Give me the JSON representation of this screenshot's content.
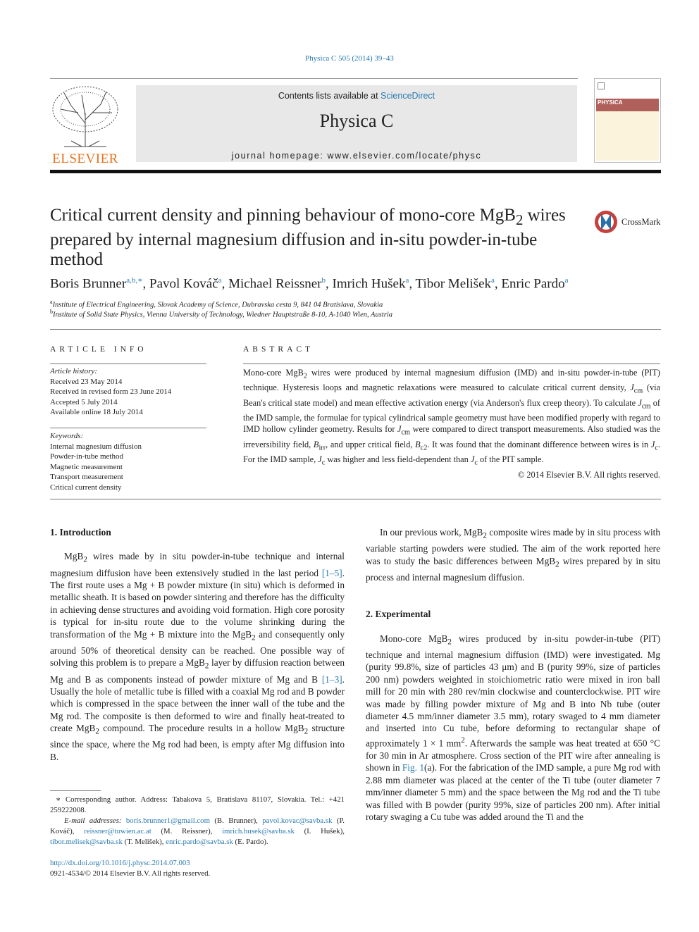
{
  "journal_ref": "Physica C 505 (2014) 39–43",
  "banner": {
    "contents_prefix": "Contents lists available at ",
    "contents_link": "ScienceDirect",
    "journal_title": "Physica C",
    "homepage": "journal homepage: www.elsevier.com/locate/physc"
  },
  "publisher_logo": "ELSEVIER",
  "cover_label": "PHYSICA",
  "crossmark": "CrossMark",
  "title": "Critical current density and pinning behaviour of mono-core MgB<sub>2</sub> wires prepared by internal magnesium diffusion and in-situ powder-in-tube method",
  "authors": "Boris Brunner<sup>a,b,∗</sup>, Pavol Kováč<sup>a</sup>, Michael Reissner<sup>b</sup>, Imrich Hušek<sup>a</sup>, Tibor Melišek<sup>a</sup>, Enric Pardo<sup>a</sup>",
  "affiliations": [
    "<sup>a</sup>Institute of Electrical Engineering, Slovak Academy of Science, Dubravska cesta 9, 841 04 Bratislava, Slovakia",
    "<sup>b</sup>Institute of Solid State Physics, Vienna University of Technology, Wiedner Hauptstraße 8-10, A-1040 Wien, Austria"
  ],
  "article_info": {
    "heading": "ARTICLE INFO",
    "history_label": "Article history:",
    "history": [
      "Received 23 May 2014",
      "Received in revised form 23 June 2014",
      "Accepted 5 July 2014",
      "Available online 18 July 2014"
    ],
    "keywords_label": "Keywords:",
    "keywords": [
      "Internal magnesium diffusion",
      "Powder-in-tube method",
      "Magnetic measurement",
      "Transport measurement",
      "Critical current density"
    ]
  },
  "abstract": {
    "heading": "ABSTRACT",
    "text": "Mono-core MgB<sub>2</sub> wires were produced by internal magnesium diffusion (IMD) and in-situ powder-in-tube (PIT) technique. Hysteresis loops and magnetic relaxations were measured to calculate critical current density, <i>J</i><sub>cm</sub> (via Bean's critical state model) and mean effective activation energy (via Anderson's flux creep theory). To calculate <i>J</i><sub>cm</sub> of the IMD sample, the formulae for typical cylindrical sample geometry must have been modified properly with regard to IMD hollow cylinder geometry. Results for <i>J</i><sub>cm</sub> were compared to direct transport measurements. Also studied was the irreversibility field, <i>B</i><sub>irr</sub>, and upper critical field, <i>B</i><sub>c2</sub>. It was found that the dominant difference between wires is in <i>J</i><sub>c</sub>. For the IMD sample, <i>J</i><sub>c</sub> was higher and less field-dependent than <i>J</i><sub>c</sub> of the PIT sample.",
    "copyright": "© 2014 Elsevier B.V. All rights reserved."
  },
  "intro": {
    "heading": "1. Introduction",
    "paragraphs": [
      "MgB<sub>2</sub> wires made by in situ powder-in-tube technique and internal magnesium diffusion have been extensively studied in the last period <a>[1–5]</a>. The first route uses a Mg + B powder mixture (in situ) which is deformed in metallic sheath. It is based on powder sintering and therefore has the difficulty in achieving dense structures and avoiding void formation. High core porosity is typical for in-situ route due to the volume shrinking during the transformation of the Mg + B mixture into the MgB<sub>2</sub> and consequently only around 50% of theoretical density can be reached. One possible way of solving this problem is to prepare a MgB<sub>2</sub> layer by diffusion reaction between Mg and B as components instead of powder mixture of Mg and B <a>[1–3]</a>. Usually the hole of metallic tube is filled with a coaxial Mg rod and B powder which is compressed in the space between the inner wall of the tube and the Mg rod. The composite is then deformed to wire and finally heat-treated to create MgB<sub>2</sub> compound. The procedure results in a hollow MgB<sub>2</sub> structure since the space, where the Mg rod had been, is empty after Mg diffusion into B.",
      "In our previous work, MgB<sub>2</sub> composite wires made by in situ process with variable starting powders were studied. The aim of the work reported here was to study the basic differences between MgB<sub>2</sub> wires prepared by in situ process and internal magnesium diffusion."
    ]
  },
  "experimental": {
    "heading": "2. Experimental",
    "paragraphs": [
      "Mono-core MgB<sub>2</sub> wires produced by in-situ powder-in-tube (PIT) technique and internal magnesium diffusion (IMD) were investigated. Mg (purity 99.8%, size of particles 43 μm) and B (purity 99%, size of particles 200 nm) powders weighted in stoichiometric ratio were mixed in iron ball mill for 20 min with 280 rev/min clockwise and counterclockwise. PIT wire was made by filling powder mixture of Mg and B into Nb tube (outer diameter 4.5 mm/inner diameter 3.5 mm), rotary swaged to 4 mm diameter and inserted into Cu tube, before deforming to rectangular shape of approximately 1 × 1 mm<sup>2</sup>. Afterwards the sample was heat treated at 650 °C for 30 min in Ar atmosphere. Cross section of the PIT wire after annealing is shown in <a>Fig. 1</a>(a). For the fabrication of the IMD sample, a pure Mg rod with 2.88 mm diameter was placed at the center of the Ti tube (outer diameter 7 mm/inner diameter 5 mm) and the space between the Mg rod and the Ti tube was filled with B powder (purity 99%, size of particles 200 nm). After initial rotary swaging a Cu tube was added around the Ti and the"
    ]
  },
  "footnotes": {
    "corresponding": "∗ Corresponding author. Address: Tabakova 5, Bratislava 81107, Slovakia. Tel.: +421 259222008.",
    "emails": "<i>E-mail addresses:</i> <a>boris.brunner1@gmail.com</a> (B. Brunner), <a>pavol.kovac@savba.sk</a> (P. Kováč), <a>reissner@tuwien.ac.at</a> (M. Reissner), <a>imrich.husek@savba.sk</a> (I. Hušek), <a>tibor.melisek@savba.sk</a> (T. Melišek), <a>enric.pardo@savba.sk</a> (E. Pardo).",
    "doi": "http://dx.doi.org/10.1016/j.physc.2014.07.003",
    "issn": "0921-4534/© 2014 Elsevier B.V. All rights reserved."
  },
  "colors": {
    "link": "#2a7ab0",
    "banner_bg": "#e8e8e8",
    "elsevier_orange": "#e9711c"
  }
}
